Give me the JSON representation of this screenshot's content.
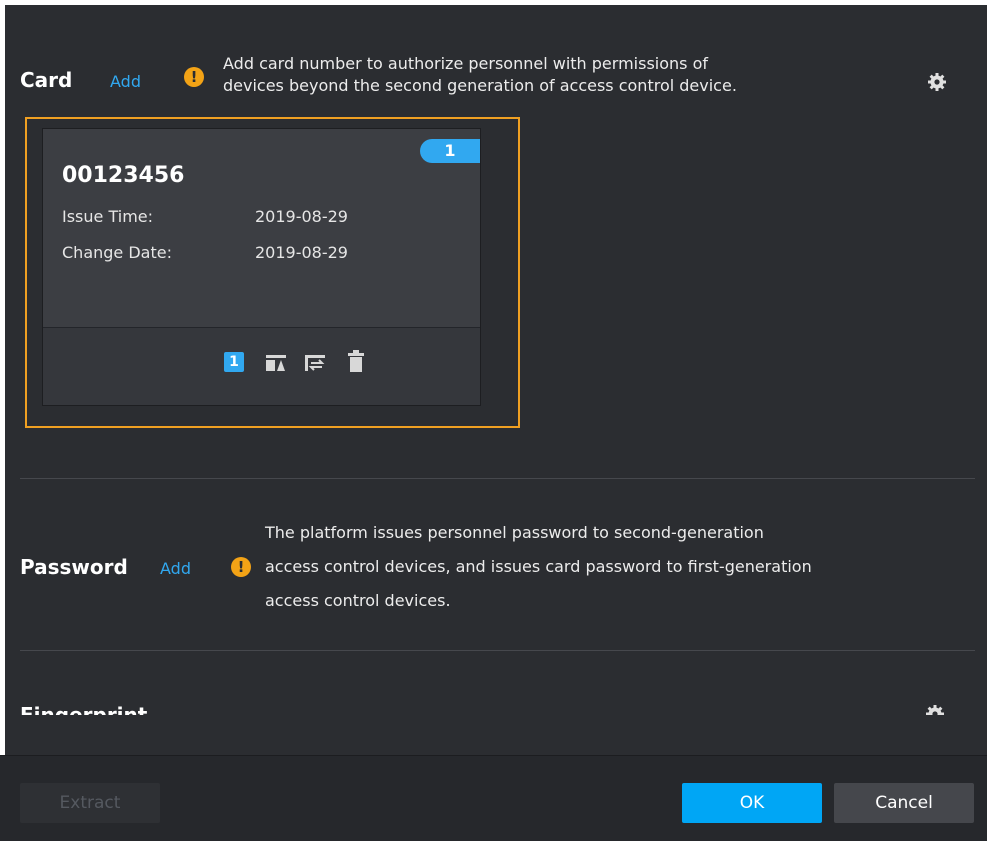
{
  "card_section": {
    "title": "Card",
    "add_label": "Add",
    "hint_line1": "Add card number to authorize personnel with permissions of",
    "hint_line2": "devices beyond the second generation of access control device.",
    "settings_icon": "gear-icon",
    "card": {
      "badge": "1",
      "number": "00123456",
      "issue_time_label": "Issue Time:",
      "issue_time_value": "2019-08-29",
      "change_date_label": "Change Date:",
      "change_date_value": "2019-08-29",
      "actions": [
        "main-card-icon",
        "issue-card-icon",
        "change-card-icon",
        "delete-icon"
      ],
      "main_card_label": "1"
    }
  },
  "password_section": {
    "title": "Password",
    "add_label": "Add",
    "hint_line1": "The platform issues personnel password to second-generation",
    "hint_line2": "access control devices, and issues card password to first-generation",
    "hint_line3": "access control devices."
  },
  "fingerprint_section": {
    "title": "Fingerprint",
    "settings_icon": "gear-icon"
  },
  "footer": {
    "extract_label": "Extract",
    "ok_label": "OK",
    "cancel_label": "Cancel"
  },
  "colors": {
    "accent": "#31a8f0",
    "warning": "#f3a316",
    "selection": "#f0a022",
    "ok_button": "#00a6f5"
  }
}
